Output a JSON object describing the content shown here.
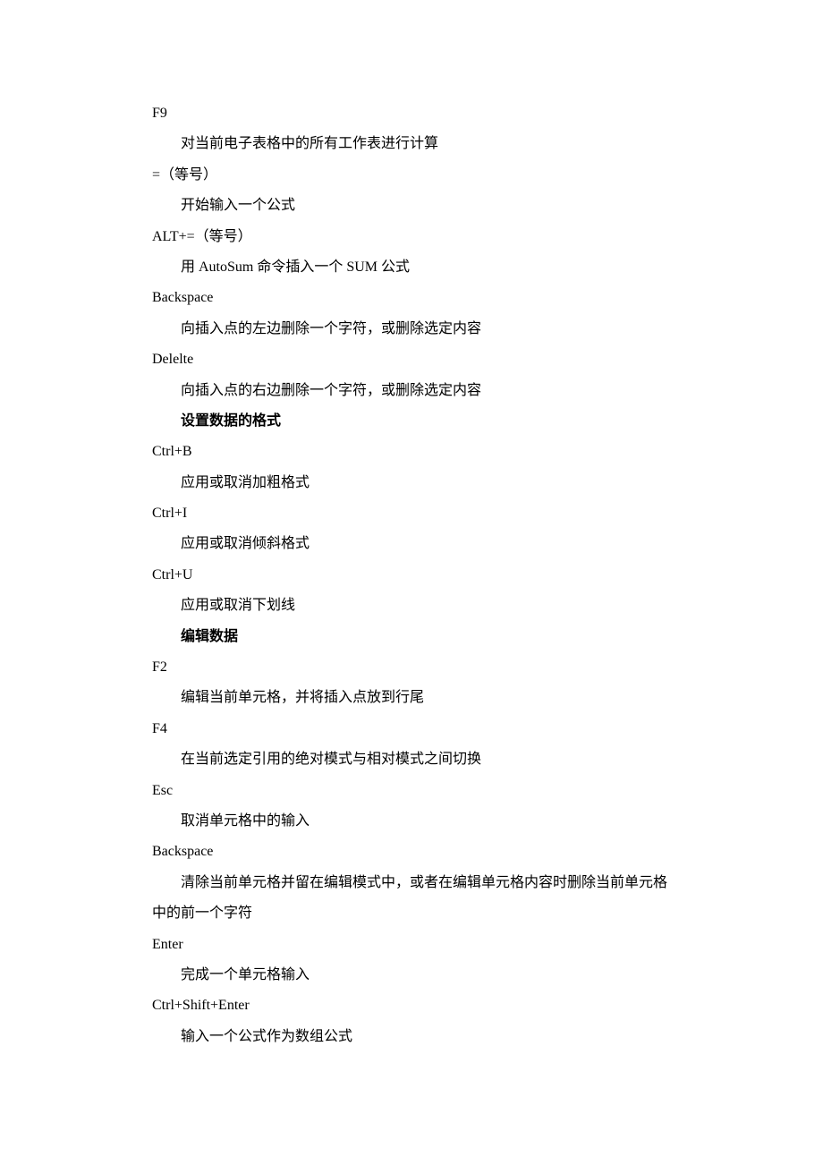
{
  "lines": [
    {
      "class": "key",
      "text": "F9"
    },
    {
      "class": "desc",
      "text": "对当前电子表格中的所有工作表进行计算"
    },
    {
      "class": "key",
      "text": "=（等号）"
    },
    {
      "class": "desc",
      "text": "开始输入一个公式"
    },
    {
      "class": "key",
      "text": "ALT+=（等号）"
    },
    {
      "class": "desc",
      "text": "用 AutoSum 命令插入一个 SUM 公式"
    },
    {
      "class": "key",
      "text": "Backspace"
    },
    {
      "class": "desc",
      "text": "向插入点的左边删除一个字符，或删除选定内容"
    },
    {
      "class": "key",
      "text": "Delelte"
    },
    {
      "class": "desc",
      "text": "向插入点的右边删除一个字符，或删除选定内容"
    },
    {
      "class": "heading",
      "text": "设置数据的格式"
    },
    {
      "class": "key",
      "text": "Ctrl+B"
    },
    {
      "class": "desc",
      "text": "应用或取消加粗格式"
    },
    {
      "class": "key",
      "text": "Ctrl+I"
    },
    {
      "class": "desc",
      "text": "应用或取消倾斜格式"
    },
    {
      "class": "key",
      "text": "Ctrl+U"
    },
    {
      "class": "desc",
      "text": "应用或取消下划线"
    },
    {
      "class": "heading",
      "text": "编辑数据"
    },
    {
      "class": "key",
      "text": "F2"
    },
    {
      "class": "desc",
      "text": "编辑当前单元格，并将插入点放到行尾"
    },
    {
      "class": "key",
      "text": "F4"
    },
    {
      "class": "desc",
      "text": "在当前选定引用的绝对模式与相对模式之间切换"
    },
    {
      "class": "key",
      "text": "Esc"
    },
    {
      "class": "desc",
      "text": "取消单元格中的输入"
    },
    {
      "class": "key",
      "text": "Backspace"
    },
    {
      "class": "desc",
      "text": "清除当前单元格并留在编辑模式中，或者在编辑单元格内容时删除当前单元格中的前一个字符"
    },
    {
      "class": "key",
      "text": "Enter"
    },
    {
      "class": "desc",
      "text": "完成一个单元格输入"
    },
    {
      "class": "key",
      "text": "Ctrl+Shift+Enter"
    },
    {
      "class": "desc",
      "text": "输入一个公式作为数组公式"
    }
  ]
}
